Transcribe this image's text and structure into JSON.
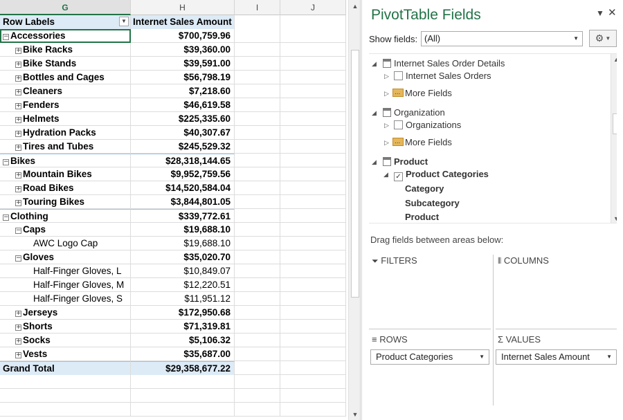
{
  "sheet": {
    "columns": [
      {
        "letter": "G",
        "selected": true
      },
      {
        "letter": "H",
        "selected": false
      },
      {
        "letter": "I",
        "selected": false
      },
      {
        "letter": "J",
        "selected": false
      }
    ],
    "header": {
      "row_labels": "Row Labels",
      "value_header": "Internet Sales Amount"
    },
    "rows": [
      {
        "label": "Accessories",
        "value": "$700,759.96",
        "level": 0,
        "toggle": "⊟",
        "bold": true,
        "active": true
      },
      {
        "label": "Bike Racks",
        "value": "$39,360.00",
        "level": 1,
        "toggle": "⊞",
        "bold": true
      },
      {
        "label": "Bike Stands",
        "value": "$39,591.00",
        "level": 1,
        "toggle": "⊞",
        "bold": true
      },
      {
        "label": "Bottles and Cages",
        "value": "$56,798.19",
        "level": 1,
        "toggle": "⊞",
        "bold": true
      },
      {
        "label": "Cleaners",
        "value": "$7,218.60",
        "level": 1,
        "toggle": "⊞",
        "bold": true
      },
      {
        "label": "Fenders",
        "value": "$46,619.58",
        "level": 1,
        "toggle": "⊞",
        "bold": true
      },
      {
        "label": "Helmets",
        "value": "$225,335.60",
        "level": 1,
        "toggle": "⊞",
        "bold": true
      },
      {
        "label": "Hydration Packs",
        "value": "$40,307.67",
        "level": 1,
        "toggle": "⊞",
        "bold": true
      },
      {
        "label": "Tires and Tubes",
        "value": "$245,529.32",
        "level": 1,
        "toggle": "⊞",
        "bold": true
      },
      {
        "label": "Bikes",
        "value": "$28,318,144.65",
        "level": 0,
        "toggle": "⊟",
        "bold": true,
        "group": true
      },
      {
        "label": "Mountain Bikes",
        "value": "$9,952,759.56",
        "level": 1,
        "toggle": "⊞",
        "bold": true
      },
      {
        "label": "Road Bikes",
        "value": "$14,520,584.04",
        "level": 1,
        "toggle": "⊞",
        "bold": true
      },
      {
        "label": "Touring Bikes",
        "value": "$3,844,801.05",
        "level": 1,
        "toggle": "⊞",
        "bold": true
      },
      {
        "label": "Clothing",
        "value": "$339,772.61",
        "level": 0,
        "toggle": "⊟",
        "bold": true,
        "group": true
      },
      {
        "label": "Caps",
        "value": "$19,688.10",
        "level": 1,
        "toggle": "⊟",
        "bold": true
      },
      {
        "label": "AWC Logo Cap",
        "value": "$19,688.10",
        "level": 2,
        "toggle": "",
        "bold": false
      },
      {
        "label": "Gloves",
        "value": "$35,020.70",
        "level": 1,
        "toggle": "⊟",
        "bold": true
      },
      {
        "label": "Half-Finger Gloves, L",
        "value": "$10,849.07",
        "level": 2,
        "toggle": "",
        "bold": false
      },
      {
        "label": "Half-Finger Gloves, M",
        "value": "$12,220.51",
        "level": 2,
        "toggle": "",
        "bold": false
      },
      {
        "label": "Half-Finger Gloves, S",
        "value": "$11,951.12",
        "level": 2,
        "toggle": "",
        "bold": false
      },
      {
        "label": "Jerseys",
        "value": "$172,950.68",
        "level": 1,
        "toggle": "⊞",
        "bold": true
      },
      {
        "label": "Shorts",
        "value": "$71,319.81",
        "level": 1,
        "toggle": "⊞",
        "bold": true
      },
      {
        "label": "Socks",
        "value": "$5,106.32",
        "level": 1,
        "toggle": "⊞",
        "bold": true
      },
      {
        "label": "Vests",
        "value": "$35,687.00",
        "level": 1,
        "toggle": "⊞",
        "bold": true
      }
    ],
    "grand_total": {
      "label": "Grand Total",
      "value": "$29,358,677.22"
    },
    "empty_rows": 3
  },
  "pane": {
    "title": "PivotTable Fields",
    "show_fields_label": "Show fields:",
    "show_fields_value": "(All)",
    "fields": [
      {
        "type": "table",
        "label": "Internet Sales Order Details"
      },
      {
        "type": "check",
        "label": "Internet Sales Orders",
        "checked": false
      },
      {
        "type": "folder",
        "label": "More Fields"
      },
      {
        "type": "table",
        "label": "Organization"
      },
      {
        "type": "check",
        "label": "Organizations",
        "checked": false
      },
      {
        "type": "folder",
        "label": "More Fields"
      },
      {
        "type": "table",
        "label": "Product",
        "bold": true
      },
      {
        "type": "check",
        "label": "Product Categories",
        "checked": true,
        "bold": true
      },
      {
        "type": "level",
        "label": "Category"
      },
      {
        "type": "level",
        "label": "Subcategory"
      },
      {
        "type": "level",
        "label": "Product"
      }
    ],
    "drag_label": "Drag fields between areas below:",
    "areas": {
      "filters": "FILTERS",
      "columns": "COLUMNS",
      "rows": "ROWS",
      "values": "VALUES",
      "rows_field": "Product Categories",
      "values_field": "Internet Sales Amount"
    }
  }
}
